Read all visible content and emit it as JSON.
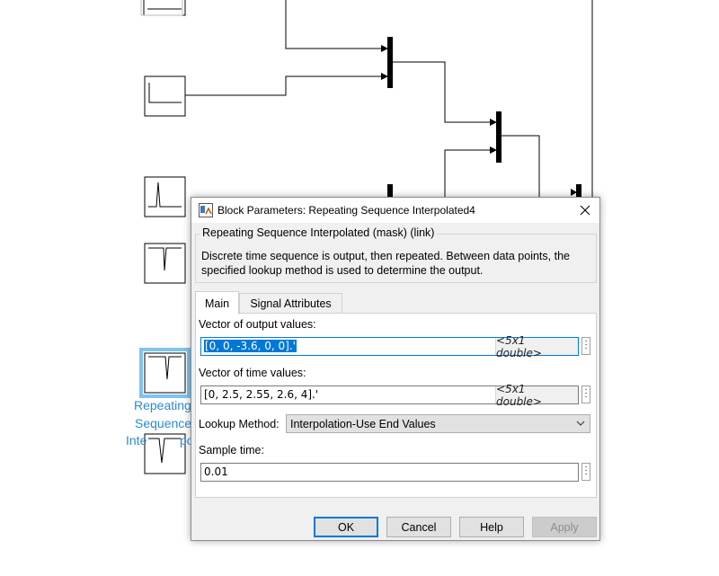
{
  "background_labels": {
    "repeating_label_line1": "Repeating",
    "repeating_label_line2": "Sequence",
    "repeating_label_line3": "Inte",
    "repeating_label_tail": "po"
  },
  "dialog": {
    "title": "Block Parameters: Repeating Sequence Interpolated4",
    "group_title": "Repeating Sequence Interpolated (mask) (link)",
    "description": "Discrete time sequence is output, then repeated. Between data points, the specified lookup method is used to determine the output.",
    "tabs": [
      {
        "label": "Main",
        "active": true
      },
      {
        "label": "Signal Attributes",
        "active": false
      }
    ],
    "output_values": {
      "label": "Vector of output values:",
      "value": "[0, 0, -3.6, 0, 0].'",
      "type": "<5x1 double>"
    },
    "time_values": {
      "label": "Vector of time values:",
      "value": "[0, 2.5, 2.55, 2.6, 4].'",
      "type": "<5x1 double>"
    },
    "lookup_method": {
      "label": "Lookup Method:",
      "selected": "Interpolation-Use End Values"
    },
    "sample_time": {
      "label": "Sample time:",
      "value": "0.01"
    },
    "buttons": {
      "ok": "OK",
      "cancel": "Cancel",
      "help": "Help",
      "apply": "Apply"
    }
  },
  "colors": {
    "selection": "#0078d7",
    "label_blue": "#2a8ad4",
    "dialog_bg": "#f0f0f0"
  },
  "icons": [
    "simulink-block-icon",
    "close-icon",
    "ellipsis-icon",
    "chevron-down-icon"
  ]
}
